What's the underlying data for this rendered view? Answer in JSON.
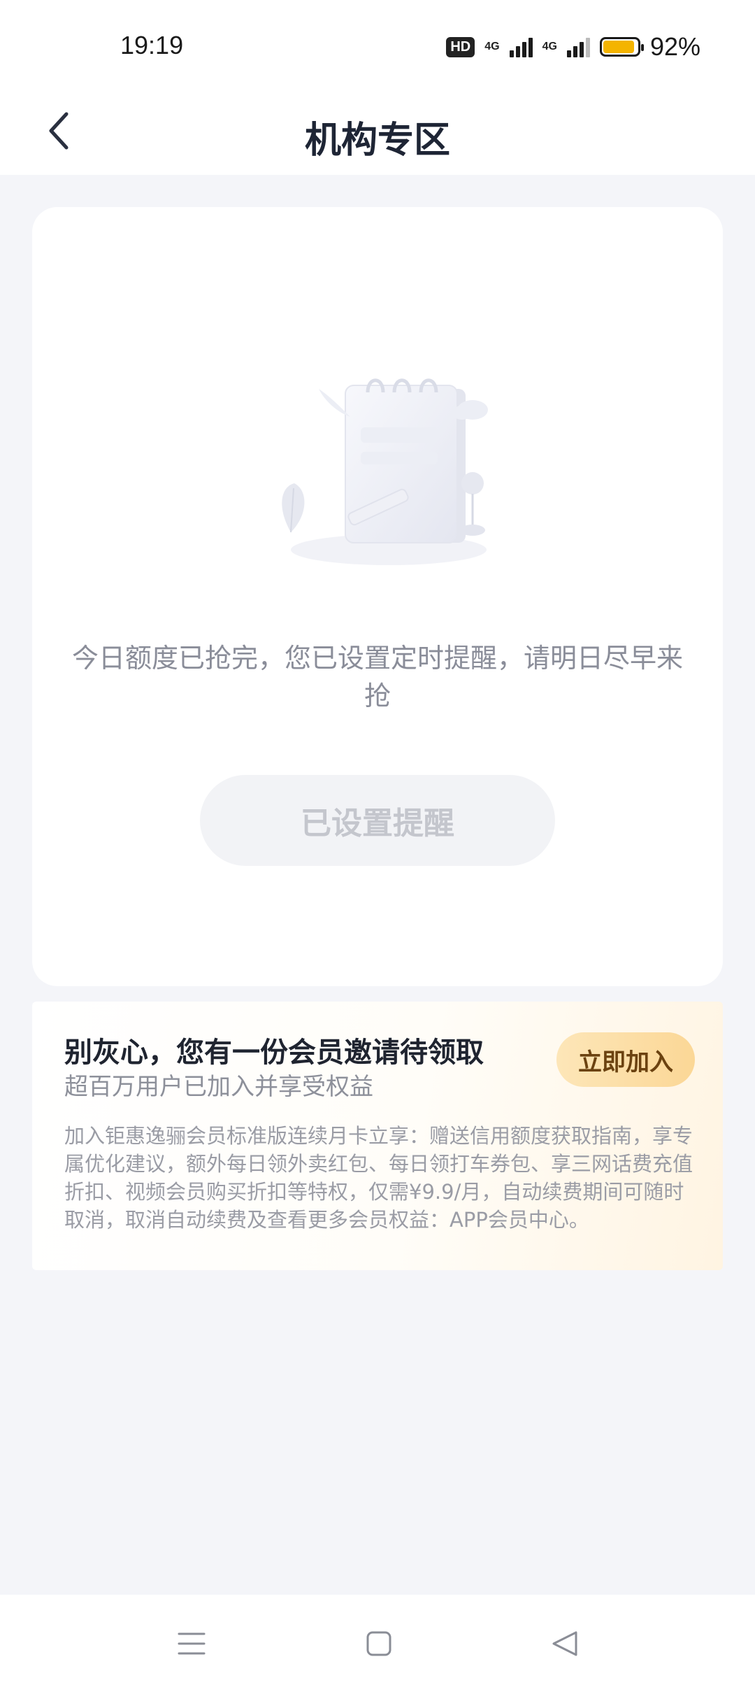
{
  "status_bar": {
    "time": "19:19",
    "hd_badge": "HD",
    "network1": "4G",
    "network2": "4G",
    "battery_percent": "92%",
    "battery_level": 0.92,
    "battery_color": "#f4b400"
  },
  "header": {
    "back_icon": "chevron-left-icon",
    "title": "机构专区"
  },
  "main_card": {
    "illustration": "empty-notebook-illustration",
    "notice_text": "今日额度已抢完，您已设置定时提醒，请明日尽早来抢",
    "remind_button_label": "已设置提醒"
  },
  "membership": {
    "title": "别灰心，您有一份会员邀请待领取",
    "subtitle": "超百万用户已加入并享受权益",
    "join_button_label": "立即加入",
    "description": "加入钜惠逸骊会员标准版连续月卡立享：赠送信用额度获取指南，享专属优化建议，额外每日领外卖红包、每日领打车券包、享三网话费充值折扣、视频会员购买折扣等特权，仅需¥9.9/月，自动续费期间可随时取消，取消自动续费及查看更多会员权益：APP会员中心。"
  },
  "system_nav": {
    "menu_icon": "menu-icon",
    "home_icon": "home-square-icon",
    "back_icon": "back-triangle-icon"
  }
}
